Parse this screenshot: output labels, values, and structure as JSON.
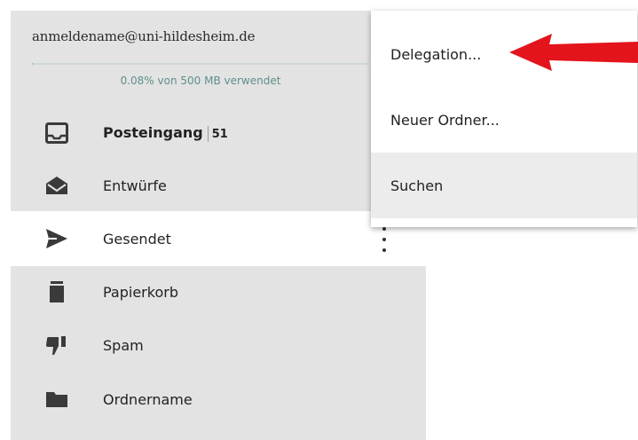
{
  "account": {
    "email": "anmeldename@uni-hildesheim.de",
    "quota_text": "0.08% von 500 MB verwendet",
    "quota_fraction": 0.0008
  },
  "folders": [
    {
      "label": "Posteingang",
      "count": "51",
      "icon": "inbox-icon"
    },
    {
      "label": "Entwürfe",
      "icon": "drafts-envelope-icon"
    },
    {
      "label": "Gesendet",
      "icon": "send-icon",
      "active": true
    },
    {
      "label": "Papierkorb",
      "icon": "trash-icon"
    },
    {
      "label": "Spam",
      "icon": "thumbs-down-icon"
    },
    {
      "label": "Ordnername",
      "icon": "folder-icon"
    }
  ],
  "context_menu": {
    "items": [
      {
        "label": "Delegation..."
      },
      {
        "label": "Neuer Ordner..."
      },
      {
        "label": "Suchen",
        "highlighted": true
      }
    ]
  },
  "colors": {
    "sidebar_bg": "#e3e3e3",
    "quota_text": "#5f8f8a",
    "quota_bar": "#8cc6bd",
    "arrow": "#e3141b"
  }
}
